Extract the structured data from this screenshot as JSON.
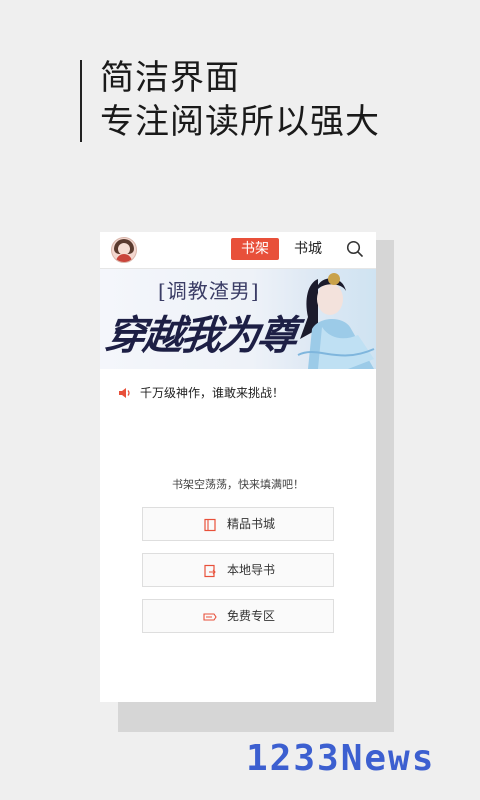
{
  "promo": {
    "line1": "简洁界面",
    "line2": "专注阅读所以强大"
  },
  "topbar": {
    "avatar_icon": "user-avatar",
    "tabs": [
      {
        "label": "书架",
        "active": true
      },
      {
        "label": "书城",
        "active": false
      }
    ],
    "search_icon": "search-icon"
  },
  "banner": {
    "small_text": "[调教渣男]",
    "big_text": "穿越我为尊"
  },
  "notice": {
    "icon": "speaker-icon",
    "text": "千万级神作，谁敢来挑战！"
  },
  "shelf": {
    "empty_text": "书架空荡荡，快来填满吧！",
    "buttons": [
      {
        "label": "精品书城",
        "icon": "book-icon"
      },
      {
        "label": "本地导书",
        "icon": "import-icon"
      },
      {
        "label": "免费专区",
        "icon": "free-tag-icon"
      }
    ]
  },
  "watermark": "1233News",
  "colors": {
    "accent": "#e8503a",
    "background": "#efefef",
    "watermark": "#3c5fd0"
  }
}
